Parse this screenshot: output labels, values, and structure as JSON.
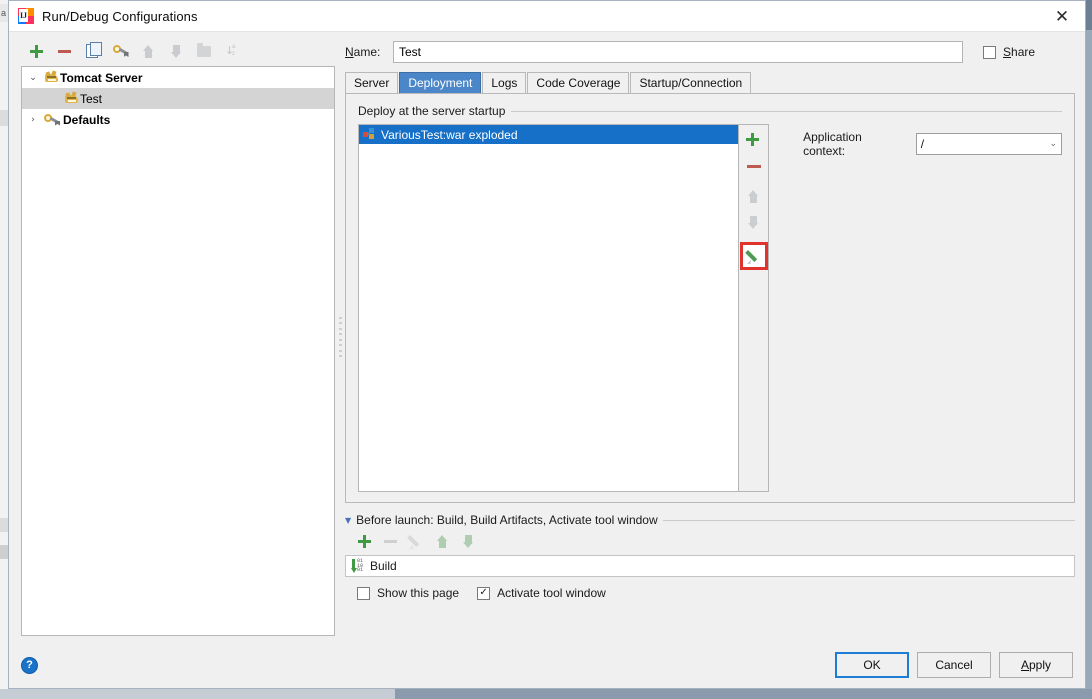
{
  "window": {
    "title": "Run/Debug Configurations",
    "app_icon": "intellij-idea-logo",
    "close_label": "✕"
  },
  "background": {
    "left_tab_label": "a"
  },
  "tree_toolbar": {
    "buttons": [
      {
        "name": "add",
        "icon": "plus-icon",
        "enabled": true
      },
      {
        "name": "remove",
        "icon": "minus-icon",
        "enabled": true
      },
      {
        "name": "copy",
        "icon": "copy-icon",
        "enabled": true
      },
      {
        "name": "edit-templates",
        "icon": "wrench-icon",
        "enabled": true
      },
      {
        "name": "move-up",
        "icon": "arrow-up-icon",
        "enabled": false
      },
      {
        "name": "move-down",
        "icon": "arrow-down-icon",
        "enabled": false
      },
      {
        "name": "move-into-folder",
        "icon": "folder-icon",
        "enabled": false
      },
      {
        "name": "sort-alphabetically",
        "icon": "sort-az-icon",
        "enabled": false
      }
    ]
  },
  "tree": {
    "nodes": [
      {
        "label": "Tomcat Server",
        "icon": "tomcat-icon",
        "expanded": true,
        "arrow": "⌄",
        "bold": true,
        "selected": false
      },
      {
        "label": "Test",
        "icon": "tomcat-icon",
        "child": true,
        "bold": false,
        "selected": true
      },
      {
        "label": "Defaults",
        "icon": "wrench-icon",
        "expanded": false,
        "arrow": "›",
        "bold": true,
        "selected": false
      }
    ]
  },
  "name_row": {
    "label": "Name:",
    "label_mnemonic": "N",
    "value": "Test",
    "placeholder": "",
    "share_label": "Share",
    "share_mnemonic": "S",
    "share_checked": false
  },
  "tabs": [
    {
      "label": "Server",
      "active": false
    },
    {
      "label": "Deployment",
      "active": true
    },
    {
      "label": "Logs",
      "active": false
    },
    {
      "label": "Code Coverage",
      "active": false
    },
    {
      "label": "Startup/Connection",
      "active": false
    }
  ],
  "deployment": {
    "group_label": "Deploy at the server startup",
    "items": [
      {
        "label": "VariousTest:war exploded",
        "icon": "artifact-icon",
        "selected": true
      }
    ],
    "side_buttons": [
      {
        "name": "add-artifact",
        "icon": "plus-icon",
        "enabled": true,
        "highlighted": false
      },
      {
        "name": "remove-artifact",
        "icon": "minus-icon",
        "enabled": true,
        "highlighted": false
      },
      {
        "name": "move-artifact-up",
        "icon": "arrow-up-icon",
        "enabled": false,
        "highlighted": false
      },
      {
        "name": "move-artifact-down",
        "icon": "arrow-down-icon",
        "enabled": false,
        "highlighted": false
      },
      {
        "name": "edit-artifact",
        "icon": "pencil-icon",
        "enabled": true,
        "highlighted": true
      }
    ],
    "highlight_color": "#e0332d",
    "application_context": {
      "label": "Application context:",
      "value": "/",
      "options": [
        "/"
      ]
    }
  },
  "before_launch": {
    "title": "Before launch: Build, Build Artifacts, Activate tool window",
    "title_mnemonic": "B",
    "toolbar": [
      {
        "name": "add-task",
        "icon": "plus-icon",
        "enabled": true
      },
      {
        "name": "remove-task",
        "icon": "minus-icon",
        "enabled": false
      },
      {
        "name": "edit-task",
        "icon": "pencil-icon",
        "enabled": false
      },
      {
        "name": "move-task-up",
        "icon": "arrow-up-icon",
        "enabled": false
      },
      {
        "name": "move-task-down",
        "icon": "arrow-down-icon",
        "enabled": false
      }
    ],
    "tasks": [
      {
        "label": "Build",
        "icon": "build-icon"
      }
    ],
    "options": [
      {
        "label": "Show this page",
        "checked": false
      },
      {
        "label": "Activate tool window",
        "checked": true
      }
    ]
  },
  "footer": {
    "help_label": "?",
    "buttons": [
      {
        "label": "OK",
        "default": true,
        "mnemonic": ""
      },
      {
        "label": "Cancel",
        "default": false,
        "mnemonic": ""
      },
      {
        "label": "Apply",
        "default": false,
        "mnemonic": "A"
      }
    ]
  },
  "colors": {
    "accent_blue": "#1670c8",
    "tab_active": "#4a86c8",
    "highlight_red": "#e0332d",
    "green": "#3f9a42",
    "dialog_bg": "#f0f0f0"
  }
}
